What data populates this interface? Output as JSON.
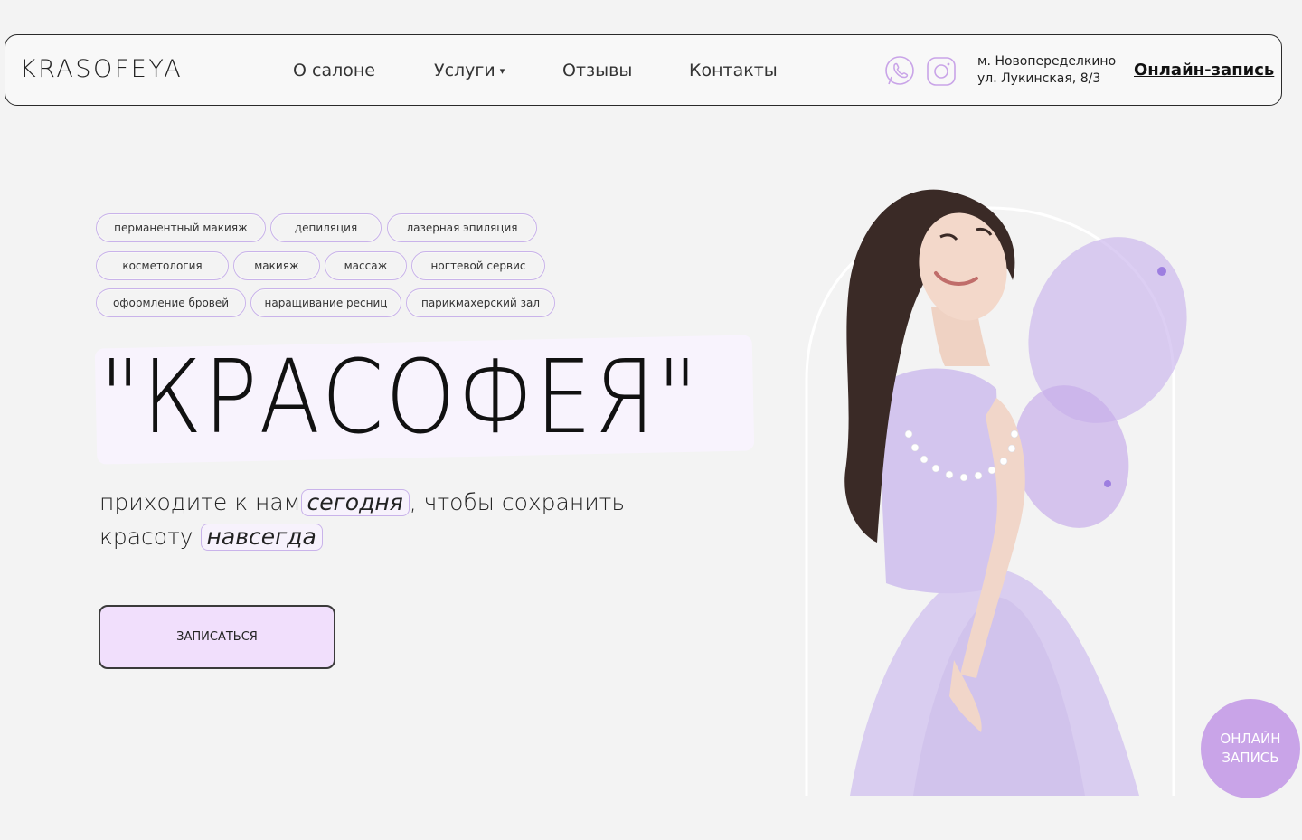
{
  "header": {
    "logo": "KRASOFEYA",
    "nav": {
      "about": "О салоне",
      "services": "Услуги",
      "reviews": "Отзывы",
      "contacts": "Контакты"
    },
    "icons": [
      "whatsapp-icon",
      "instagram-icon"
    ],
    "address_line1": "м. Новопеределкино",
    "address_line2": "ул. Лукинская, 8/3",
    "online_booking": "Онлайн-запись"
  },
  "tags": [
    "перманентный макияж",
    "депиляция",
    "лазерная эпиляция",
    "косметология",
    "макияж",
    "массаж",
    "ногтевой сервис",
    "оформление бровей",
    "наращивание ресниц",
    "парикмахерский зал"
  ],
  "hero": {
    "title": "\"КРАСОФЕЯ\"",
    "subtitle_part1": "приходите к нам",
    "subtitle_highlight1": "сегодня",
    "subtitle_part2": ", чтобы сохранить",
    "subtitle_part3": "красоту",
    "subtitle_highlight2": "навсегда",
    "cta": "ЗАПИСАТЬСЯ"
  },
  "floating_button": {
    "line1": "ОНЛАЙН",
    "line2": "ЗАПИСЬ"
  },
  "colors": {
    "accent": "#c9a4e8",
    "tag_border": "#c9b3ea",
    "cta_bg": "#f1dffc",
    "background": "#f3f3f3"
  }
}
